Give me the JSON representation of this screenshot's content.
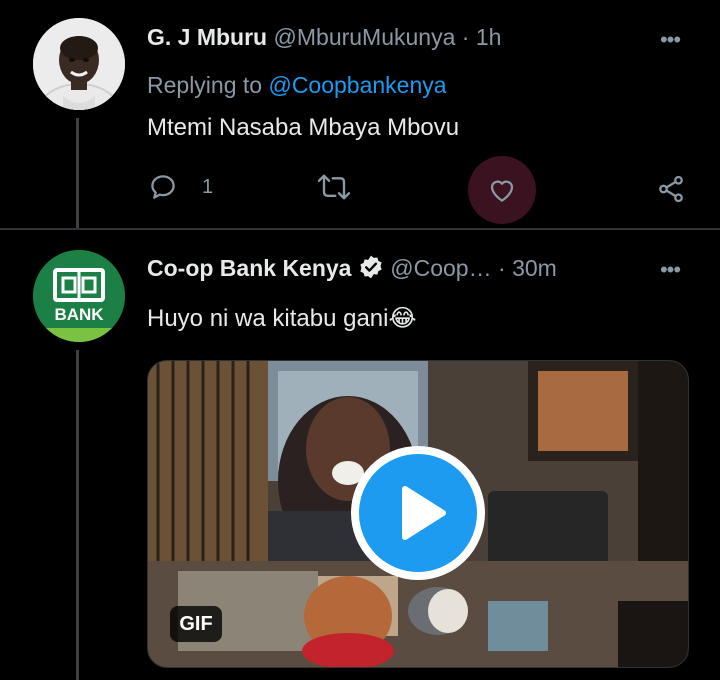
{
  "tweets": [
    {
      "author_name": "G. J Mburu",
      "handle": "@MburuMukunya",
      "separator": "·",
      "time": "1h",
      "replying_prefix": "Replying to",
      "replying_to": "@Coopbankenya",
      "text": "Mtemi Nasaba Mbaya Mbovu",
      "reply_count": "1",
      "more_icon": "more-dots-icon"
    },
    {
      "author_name": "Co-op Bank Kenya",
      "verified": true,
      "handle": "@Coop…",
      "separator": "·",
      "time": "30m",
      "text": "Huyo ni wa kitabu gani",
      "emoji": "😂",
      "avatar_text": "BANK",
      "media": {
        "type": "gif",
        "badge": "GIF"
      }
    }
  ],
  "colors": {
    "background": "#000000",
    "text": "#e7e9ea",
    "muted": "#8b98a5",
    "accent": "#1d9bf0",
    "like_active_bg": "#3b1220",
    "avatar_green": "#1c7f45"
  }
}
